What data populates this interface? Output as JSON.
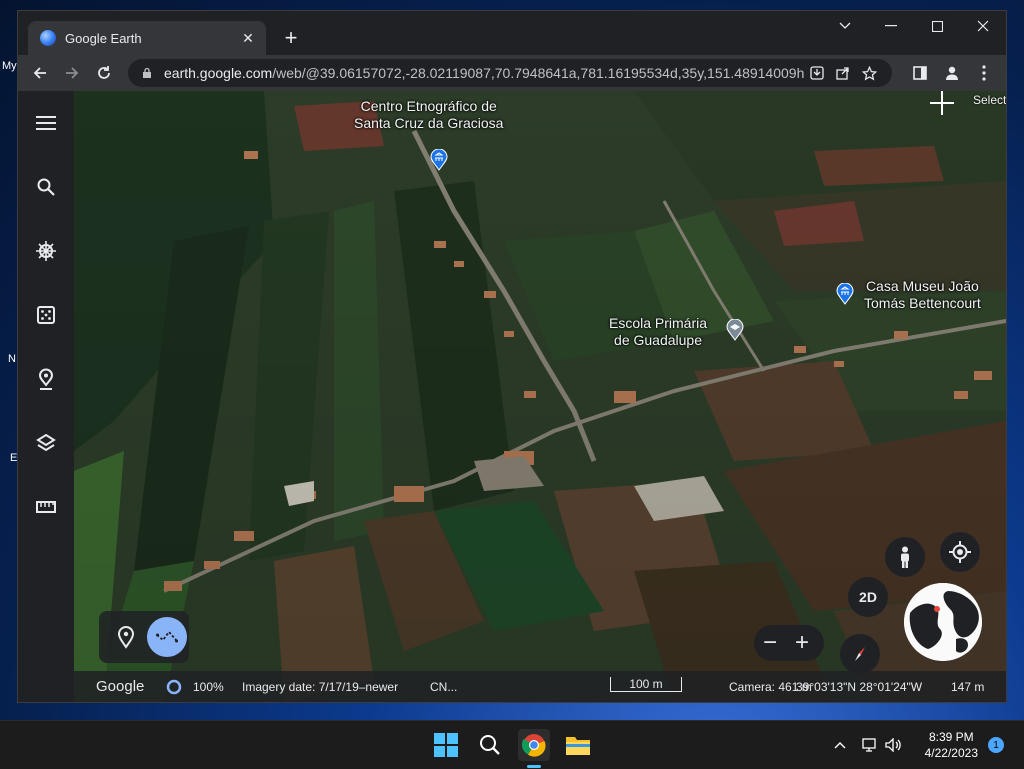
{
  "desktop": {
    "icon_labels": [
      "My",
      "N",
      "E"
    ]
  },
  "browser": {
    "tab_title": "Google Earth",
    "url_host": "earth.google.com",
    "url_path": "/web/@39.06157072,-28.02119087,70.7948641a,781.16195534d,35y,151.48914009h..."
  },
  "earth": {
    "labels": {
      "centro": [
        "Centro Etnográfico de",
        "Santa Cruz da Graciosa"
      ],
      "casa_museu": [
        "Casa Museu João",
        "Tomás Bettencourt"
      ],
      "escola": [
        "Escola Primária",
        "de Guadalupe"
      ]
    },
    "select_label": "Select",
    "view_mode": "2D",
    "status": {
      "brand": "Google",
      "load_progress": "100%",
      "imagery_date": "Imagery date: 7/17/19–newer",
      "attribution": "CN...",
      "scale": "100 m",
      "camera": "Camera: 461 m",
      "coords": "39°03'13\"N 28°01'24\"W",
      "elevation": "147 m"
    }
  },
  "taskbar": {
    "time": "8:39 PM",
    "date": "4/22/2023",
    "notification_count": "1"
  },
  "colors": {
    "chrome_dark": "#202124",
    "chrome_toolbar": "#35363a",
    "accent_blue": "#8ab4f8",
    "pin_blue": "#1a73e8"
  }
}
